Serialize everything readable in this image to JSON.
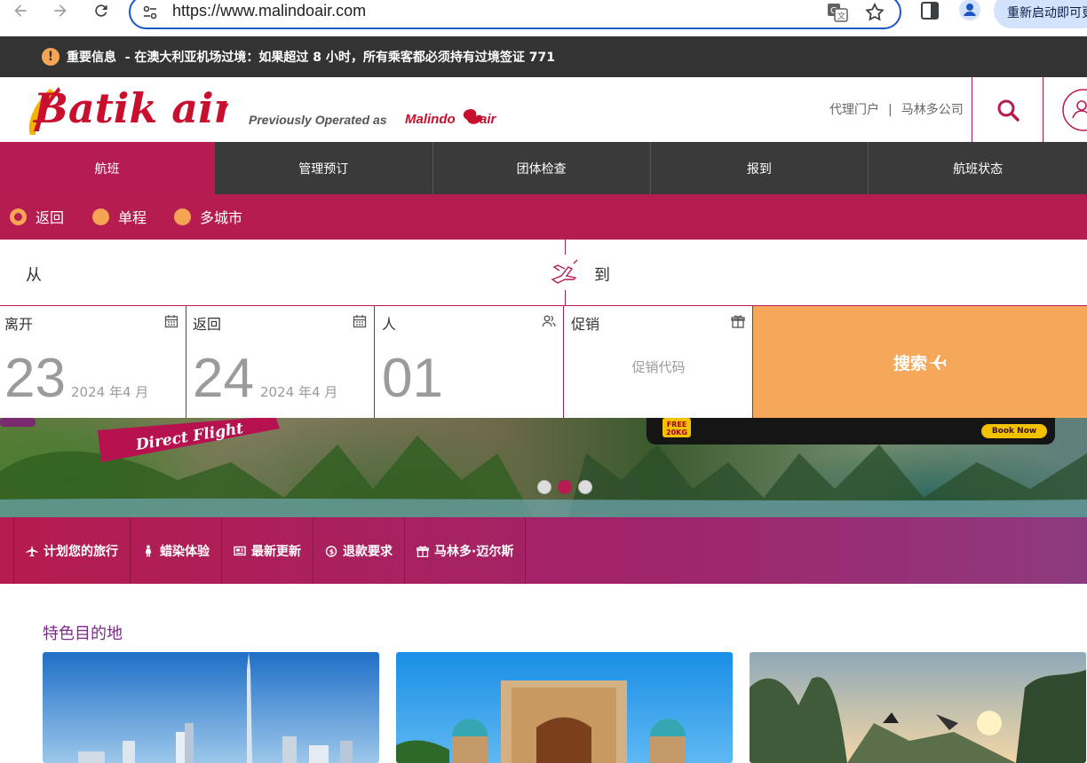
{
  "browser": {
    "url": "https://www.malindoair.com",
    "relaunch_label": "重新启动即可更新"
  },
  "notice": {
    "icon": "!",
    "text": "重要信息  - 在澳大利亚机场过境：如果超过 8 小时，所有乘客都必须持有过境签证 771"
  },
  "header": {
    "previously_operated": "Previously Operated as",
    "links": [
      "代理门户",
      "马林多公司"
    ],
    "link_separator": "|"
  },
  "mainnav": {
    "tabs": [
      {
        "label": "航班",
        "active": true
      },
      {
        "label": "管理预订",
        "active": false
      },
      {
        "label": "团体检查",
        "active": false
      },
      {
        "label": "报到",
        "active": false
      },
      {
        "label": "航班状态",
        "active": false
      }
    ]
  },
  "triptype": {
    "options": [
      {
        "label": "返回",
        "selected": true
      },
      {
        "label": "单程",
        "selected": false
      },
      {
        "label": "多城市",
        "selected": false
      }
    ]
  },
  "route": {
    "from_label": "从",
    "to_label": "到"
  },
  "fields": {
    "depart": {
      "label": "离开",
      "day": "23",
      "month": "2024 年4 月"
    },
    "return": {
      "label": "返回",
      "day": "24",
      "month": "2024 年4 月"
    },
    "people": {
      "label": "人",
      "count": "01"
    },
    "promo": {
      "label": "促销",
      "placeholder": "促销代码"
    },
    "search_label": "搜索"
  },
  "banner": {
    "headline": "Direct Flight",
    "free_badge": "FREE 20KG",
    "book_now": "Book Now",
    "slides": 3,
    "active_slide": 2
  },
  "quicklinks": [
    {
      "label": "计划您的旅行",
      "icon": "plane-icon"
    },
    {
      "label": "蜡染体验",
      "icon": "person-icon"
    },
    {
      "label": "最新更新",
      "icon": "newspaper-icon"
    },
    {
      "label": "退款要求",
      "icon": "refund-icon"
    },
    {
      "label": "马林多·迈尔斯",
      "icon": "gift-icon"
    }
  ],
  "featured": {
    "title": "特色目的地"
  },
  "colors": {
    "brand": "#b51c52",
    "accent": "#f5a453",
    "nav_dark": "#3a3a3a"
  }
}
